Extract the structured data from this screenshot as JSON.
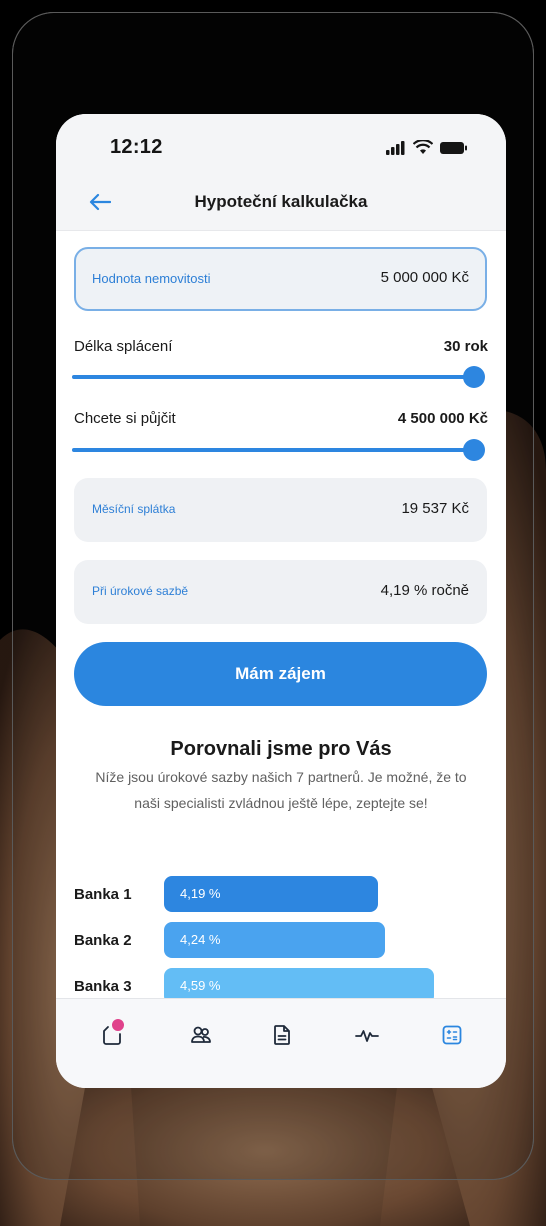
{
  "status_bar": {
    "time": "12:12"
  },
  "header": {
    "title": "Hypoteční kalkulačka"
  },
  "property_value": {
    "label": "Hodnota nemovitosti",
    "value": "5 000 000 Kč"
  },
  "repayment_length": {
    "label": "Délka splácení",
    "value": "30 rok",
    "slider_level": 1.0
  },
  "loan_amount": {
    "label": "Chcete si půjčit",
    "value": "4 500 000 Kč",
    "slider_level": 1.0
  },
  "monthly_payment": {
    "label": "Měsíční splátka",
    "value": "19 537 Kč"
  },
  "interest_rate": {
    "label": "Při úrokové sazbě",
    "value": "4,19 % ročně"
  },
  "cta": {
    "label": "Mám zájem"
  },
  "comparison": {
    "title": "Porovnali jsme pro Vás",
    "text": "Níže jsou úrokové sazby našich 7 partnerů. Je možné, že to naši specialisti zvládnou ještě lépe, zeptejte se!",
    "banks": [
      {
        "name": "Banka 1",
        "rate": "4,19 %",
        "rate_value": 4.19,
        "color": "#2d86e0"
      },
      {
        "name": "Banka 2",
        "rate": "4,24 %",
        "rate_value": 4.24,
        "color": "#4aa3ef"
      },
      {
        "name": "Banka 3",
        "rate": "4,59 %",
        "rate_value": 4.59,
        "color": "#63bdf5"
      }
    ]
  },
  "tabbar": {
    "items": [
      {
        "icon": "inbox-icon",
        "badge": true
      },
      {
        "icon": "users-icon"
      },
      {
        "icon": "document-icon"
      },
      {
        "icon": "activity-icon"
      },
      {
        "icon": "calculator-icon",
        "active": true
      }
    ]
  },
  "colors": {
    "accent": "#2b86df",
    "badge": "#e0428b",
    "label_blue": "#2d7fd6"
  }
}
